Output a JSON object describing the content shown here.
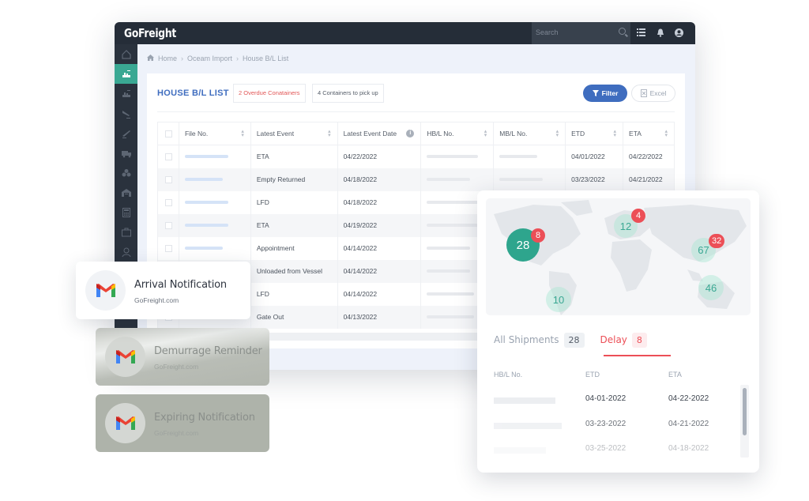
{
  "app": {
    "logo": "GoFreight",
    "search_placeholder": "Search",
    "topbar_icons": [
      "list-icon",
      "bell-icon",
      "user-icon"
    ]
  },
  "sidebar": {
    "items": [
      {
        "icon": "home-icon",
        "active": false
      },
      {
        "icon": "ocean-import-icon",
        "active": true
      },
      {
        "icon": "ocean-export-icon",
        "active": false
      },
      {
        "icon": "air-import-icon",
        "active": false
      },
      {
        "icon": "air-export-icon",
        "active": false
      },
      {
        "icon": "truck-icon",
        "active": false
      },
      {
        "icon": "boxes-icon",
        "active": false
      },
      {
        "icon": "warehouse-icon",
        "active": false
      },
      {
        "icon": "calculator-icon",
        "active": false
      },
      {
        "icon": "briefcase-icon",
        "active": false
      },
      {
        "icon": "contacts-icon",
        "active": false
      }
    ]
  },
  "breadcrumb": [
    "Home",
    "Oceam Import",
    "House B/L List"
  ],
  "page": {
    "title": "HOUSE B/L LIST",
    "chip_overdue": "2 Overdue Conatainers",
    "chip_pickup": "4 Containers to pick up",
    "filter_label": "Filter",
    "excel_label": "Excel"
  },
  "table": {
    "columns": [
      "File No.",
      "Latest Event",
      "Latest Event Date",
      "HB/L No.",
      "MB/L No.",
      "ETD",
      "ETA"
    ],
    "rows": [
      {
        "event": "ETA",
        "date": "04/22/2022",
        "etd": "04/01/2022",
        "eta": "04/22/2022"
      },
      {
        "event": "Empty Returned",
        "date": "04/18/2022",
        "etd": "03/23/2022",
        "eta": "04/21/2022"
      },
      {
        "event": "LFD",
        "date": "04/18/2022",
        "etd": "",
        "eta": ""
      },
      {
        "event": "ETA",
        "date": "04/19/2022",
        "etd": "",
        "eta": ""
      },
      {
        "event": "Appointment",
        "date": "04/14/2022",
        "etd": "",
        "eta": ""
      },
      {
        "event": "Unloaded from Vessel",
        "date": "04/14/2022",
        "etd": "",
        "eta": ""
      },
      {
        "event": "LFD",
        "date": "04/14/2022",
        "etd": "",
        "eta": ""
      },
      {
        "event": "Gate Out",
        "date": "04/13/2022",
        "etd": "",
        "eta": ""
      }
    ]
  },
  "notifications": [
    {
      "title": "Arrival Notification",
      "sender": "GoFreight.com"
    },
    {
      "title": "Demurrage Reminder",
      "sender": "GoFreight.com"
    },
    {
      "title": "Expiring Notification",
      "sender": "GoFreight.com"
    }
  ],
  "map": {
    "clusters": [
      {
        "region": "north-america",
        "count": "28",
        "delay": "8"
      },
      {
        "region": "europe",
        "count": "12",
        "delay": "4"
      },
      {
        "region": "east-asia",
        "count": "67",
        "delay": "32"
      },
      {
        "region": "south-america",
        "count": "10",
        "delay": ""
      },
      {
        "region": "oceania",
        "count": "46",
        "delay": ""
      }
    ]
  },
  "shipments": {
    "tab_all": "All Shipments",
    "tab_all_count": "28",
    "tab_delay": "Delay",
    "tab_delay_count": "8",
    "columns": [
      "HB/L No.",
      "ETD",
      "ETA"
    ],
    "rows": [
      {
        "etd": "04-01-2022",
        "eta": "04-22-2022"
      },
      {
        "etd": "03-23-2022",
        "eta": "04-21-2022"
      },
      {
        "etd": "03-25-2022",
        "eta": "04-18-2022"
      }
    ]
  },
  "colors": {
    "brand_dark": "#252d38",
    "accent_green": "#3aa893",
    "accent_blue": "#3f6dbf",
    "alert_red": "#ec4f57"
  }
}
